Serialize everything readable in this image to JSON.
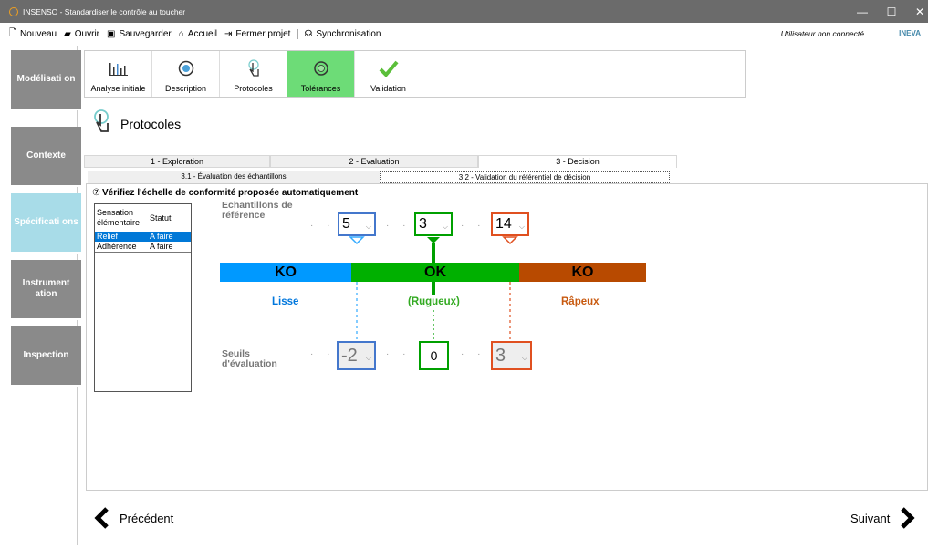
{
  "window": {
    "title": "INSENSO - Standardiser le contrôle au toucher"
  },
  "menu": {
    "items": [
      "Nouveau",
      "Ouvrir",
      "Sauvegarder",
      "Accueil",
      "Fermer projet",
      "Synchronisation"
    ],
    "user": "Utilisateur non connecté",
    "logo": "INEVA"
  },
  "sidebar": {
    "items": [
      "Modélisati on",
      "Contexte",
      "Spécificati ons",
      "Instrument ation",
      "Inspection"
    ]
  },
  "toolbar": {
    "items": [
      "Analyse initiale",
      "Description",
      "Protocoles",
      "Tolérances",
      "Validation"
    ],
    "active": "Tolérances"
  },
  "page": {
    "title": "Protocoles"
  },
  "tabs": [
    "1 - Exploration",
    "2 - Evaluation",
    "3 - Decision"
  ],
  "subtabs": [
    "3.1 - Évaluation des échantillons",
    "3.2 - Validation du référentiel de décision"
  ],
  "question": "Vérifiez l'échelle de conformité proposée automatiquement",
  "list": {
    "headers": [
      "Sensation élémentaire",
      "Statut"
    ],
    "rows": [
      {
        "sensation": "Relief",
        "statut": "A faire"
      },
      {
        "sensation": "Adhérence",
        "statut": "A faire"
      }
    ]
  },
  "scale": {
    "ref_label": "Echantillons de référence",
    "ref_values": [
      "5",
      "3",
      "14"
    ],
    "zones": [
      "KO",
      "OK",
      "KO"
    ],
    "zone_labels": [
      "Lisse",
      "(Rugueux)",
      "Râpeux"
    ],
    "seuils_label": "Seuils d'évaluation",
    "seuil_values": [
      "-2",
      "0",
      "3"
    ],
    "colors": {
      "left": "#0099ff",
      "mid": "#00b000",
      "right": "#b84a00",
      "left_border": "#4477cc",
      "right_border": "#e05020"
    }
  },
  "nav": {
    "prev": "Précédent",
    "next": "Suivant"
  }
}
